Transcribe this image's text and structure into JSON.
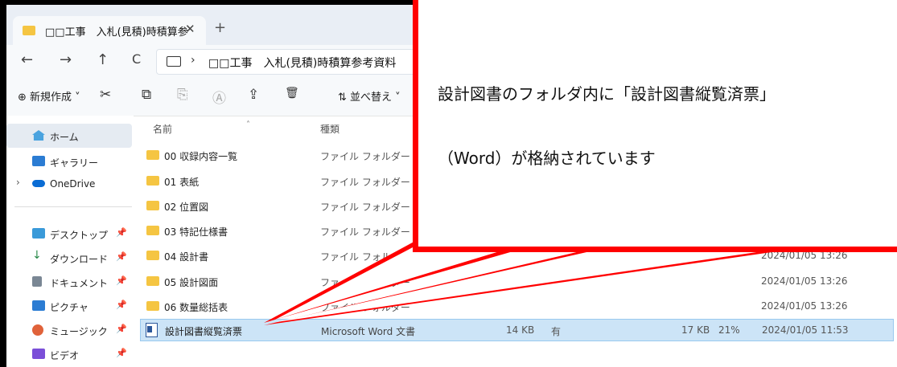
{
  "tab": {
    "title": "□□工事　入札(見積)時積算参",
    "close": "✕",
    "new": "+"
  },
  "nav": {
    "back": "←",
    "forward": "→",
    "up": "↑",
    "refresh": "C"
  },
  "address": {
    "separator": "›",
    "path": "□□工事　入札(見積)時積算参考資料"
  },
  "toolbar": {
    "new_label": "⊕ 新規作成 ˅",
    "cut": "✂",
    "copy": "⧉",
    "paste": "⎘",
    "rename": "Ⓐ",
    "share": "⇪",
    "delete": "🗑",
    "sort_label": "⇅ 並べ替え ˅"
  },
  "sidebar": {
    "items": [
      {
        "label": "ホーム",
        "color": "#4aa3df"
      },
      {
        "label": "ギャラリー",
        "color": "#2b7cd3"
      },
      {
        "label": "OneDrive",
        "color": "#0a6cd4",
        "expander": "›"
      },
      {
        "label": "デスクトップ",
        "color": "#3a9ad9",
        "pin": "📌"
      },
      {
        "label": "ダウンロード",
        "color": "#2a8a4a",
        "pin": "📌"
      },
      {
        "label": "ドキュメント",
        "color": "#7a8794",
        "pin": "📌"
      },
      {
        "label": "ピクチャ",
        "color": "#2b7cd3",
        "pin": "📌"
      },
      {
        "label": "ミュージック",
        "color": "#e0623a",
        "pin": "📌"
      },
      {
        "label": "ビデオ",
        "color": "#7b4fd8",
        "pin": "📌"
      }
    ]
  },
  "columns": {
    "name": "名前",
    "type": "種類",
    "sort_caret": "˄"
  },
  "rows": [
    {
      "name": "00 収録内容一覧",
      "type": "ファイル フォルダー",
      "date": ""
    },
    {
      "name": "01 表紙",
      "type": "ファイル フォルダー",
      "date": ""
    },
    {
      "name": "02 位置図",
      "type": "ファイル フォルダー",
      "date": ""
    },
    {
      "name": "03 特記仕様書",
      "type": "ファイル フォルダー",
      "date": ""
    },
    {
      "name": "04 設計書",
      "type": "ファイル フォルダー",
      "date": "2024/01/05 13:26"
    },
    {
      "name": "05 設計図面",
      "type": "ファイル フォルダー",
      "date": "2024/01/05 13:26"
    },
    {
      "name": "06 数量総括表",
      "type": "ファイル フォルダー",
      "date": "2024/01/05 13:26"
    }
  ],
  "file_row": {
    "name": "設計図書縦覧済票",
    "type": "Microsoft Word 文書",
    "size": "14 KB",
    "protected": "有",
    "compressed": "17 KB",
    "ratio": "21%",
    "date": "2024/01/05 11:53"
  },
  "callout": {
    "line1": "設計図書のフォルダ内に「設計図書縦覧済票」",
    "line2": "（Word）が格納されています",
    "color": "#ff0000"
  }
}
